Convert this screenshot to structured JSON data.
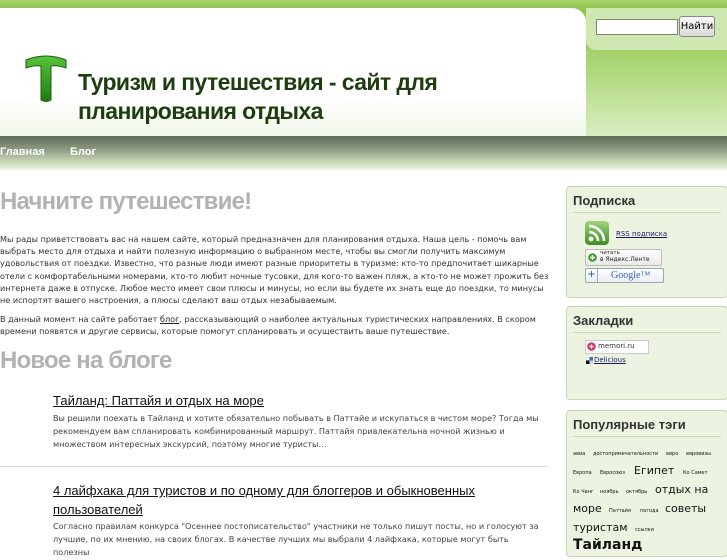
{
  "header": {
    "title_line1": "Туризм и путешествия - сайт для",
    "title_line2": "планирования отдыха"
  },
  "search": {
    "placeholder": "",
    "button_label": "Найти"
  },
  "nav": {
    "items": [
      {
        "label": "Главная"
      },
      {
        "label": "Блог"
      }
    ]
  },
  "main": {
    "heading": "Начните путешествие!",
    "intro_p1": "Мы рады приветствовать вас на нашем сайте, который предназначен для планирования отдыха. Наша цель - помочь вам выбрать место для отдыха и найти полезную информацию о выбранном месте, чтобы вы смогли получить максимум удовольствия от поездки. Известно, что разные люди имеют разные приоритеты в туризме: кто-то предпочитает шикарные отели с комфортабельными номерами, кто-то любит ночные тусовки, для кого-то важен пляж, а кто-то не может прожить без интернета даже в отпуске. Любое место имеет свои плюсы и минусы, но если вы будете их знать еще до поездки, то минусы не испортят вашего настроения, а плюсы сделают ваш отдых незабываемым.",
    "intro_p2_before": "В данный момент на сайте работает ",
    "intro_p2_link": "блог",
    "intro_p2_after": ", рассказывающий о наиболее актуальных туристических направлениях. В скором времени появятся и другие сервисы, которые помогут спланировать и осуществить ваше путешествие.",
    "blog_heading": "Новое на блоге",
    "posts": [
      {
        "title": "Тайланд: Паттайя и отдых на море",
        "excerpt": "Вы решили поехать в Тайланд и хотите обязательно побывать в Паттайе и искупаться в чистом море? Тогда мы рекомендуем вам спланировать комбинированный маршрут. Паттайя привлекательна ночной жизнью и множеством интересных экскурсий, поэтому многие туристы…"
      },
      {
        "title_line1": "4 лайфхака для туристов и по одному для блоггеров и обыкновенных",
        "title_line2": "пользователей",
        "excerpt": "Согласно правилам конкурса \"Осеннее постописательство\" участники не только пишут посты, но и голосуют за лучшие, по их мнению, на своих блогах. В качестве лучших мы выбрали 4 лайфхака, которые могут быть полезны"
      }
    ]
  },
  "sidebar": {
    "subscribe": {
      "title": "Подписка",
      "rss_label": "RSS подписка",
      "yandex_line1": "читать",
      "yandex_line2": "в Яндекс.Ленте",
      "google_label": "Google™"
    },
    "bookmarks": {
      "title": "Закладки",
      "memori_label": "memori.ru",
      "delicious_label": "Delicious"
    },
    "tags": {
      "title": "Популярные тэги",
      "items": [
        {
          "label": "авиа"
        },
        {
          "label": "достопримечательности"
        },
        {
          "label": "евро"
        },
        {
          "label": "евровизы"
        },
        {
          "label": "Европа"
        },
        {
          "label": "Евросоюз"
        },
        {
          "label": "Египет"
        },
        {
          "label": "Ко Самет"
        },
        {
          "label": "Ко Чанг"
        },
        {
          "label": "ноябрь"
        },
        {
          "label": "октябрь"
        },
        {
          "label": "отдых на"
        },
        {
          "label": "море"
        },
        {
          "label": "Паттайя"
        },
        {
          "label": "погода"
        },
        {
          "label": "советы"
        },
        {
          "label": "туристам"
        },
        {
          "label": "ссылки"
        },
        {
          "label": "Тайланд"
        }
      ]
    }
  },
  "colors": {
    "brand_green": "#2f9a1e",
    "header_text": "#1d3d0f",
    "heading_grey": "#b2b2b2"
  }
}
